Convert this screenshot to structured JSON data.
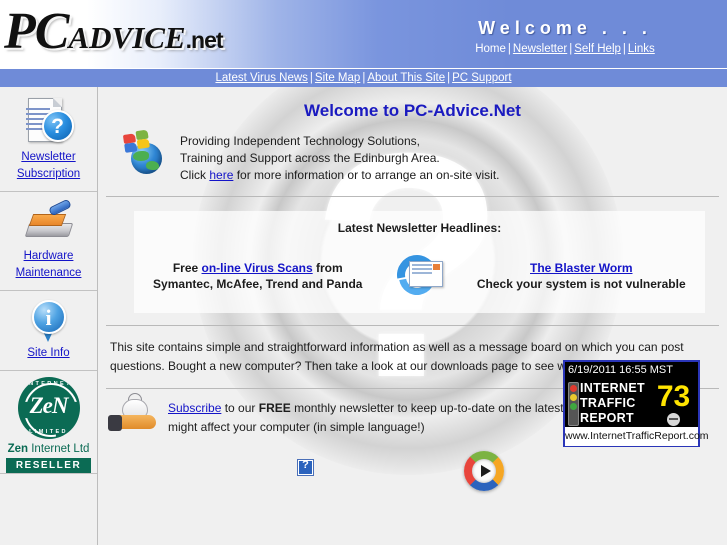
{
  "header": {
    "logo": {
      "pc": "PC",
      "advice": "ADVICE",
      "net": ".net",
      "alt": "PC-Advice.net logo"
    },
    "welcome_title": "Welcome . . .",
    "nav": [
      {
        "label": "Home",
        "link": false
      },
      {
        "label": "Newsletter",
        "link": true
      },
      {
        "label": "Self Help",
        "link": true
      },
      {
        "label": "Links",
        "link": true
      }
    ],
    "separator": "|"
  },
  "subnav": {
    "items": [
      {
        "label": "Latest Virus News"
      },
      {
        "label": "Site Map"
      },
      {
        "label": "About This Site"
      },
      {
        "label": "PC Support"
      }
    ],
    "separator": "|"
  },
  "sidebar": {
    "items": [
      {
        "label_line1": "Newsletter",
        "label_line2": "Subscription",
        "icon": "document-question-icon"
      },
      {
        "label_line1": "Hardware",
        "label_line2": "Maintenance",
        "icon": "hard-drive-brush-icon"
      },
      {
        "label_line1": "Site Info",
        "label_line2": "",
        "icon": "info-bubble-icon"
      }
    ],
    "zen": {
      "mark_text": "ZeN",
      "ring_top": "INTERNET",
      "ring_bottom": "LIMITED",
      "name_bold": "Zen",
      "name_rest": " Internet Ltd",
      "badge": "RESELLER"
    }
  },
  "main": {
    "page_title": "Welcome to PC-Advice.Net",
    "intro": {
      "line1": "Providing Independent Technology Solutions,",
      "line2": "Training and Support across the Edinburgh Area.",
      "line3_pre": "Click ",
      "line3_link": "here",
      "line3_post": " for more information or to arrange an on-site visit."
    },
    "newsletter": {
      "heading": "Latest Newsletter Headlines:",
      "left_pre": "Free ",
      "left_link": "on-line Virus Scans",
      "left_post": " from Symantec, McAfee, Trend and Panda",
      "right_link": "The Blaster Worm",
      "right_post": "Check your system is not vulnerable",
      "icon": "mail-refresh-icon"
    },
    "paragraph": "This site contains simple and straightforward information as well as a message board on which you can post questions. Bought a new computer? Then take a look at our downloads page to see what software you need.",
    "subscribe": {
      "link": "Subscribe",
      "pre": "",
      "mid1": " to our ",
      "bold": "FREE",
      "mid2": " monthly newsletter to keep up-to-date on the latest technology and how it might affect your computer (in simple language!)",
      "icon": "mouse-in-hand-icon"
    }
  },
  "traffic_report": {
    "datetime": "6/19/2011 16:55 MST",
    "title_line1": "INTERNET",
    "title_line2": "TRAFFIC",
    "title_line3": "REPORT",
    "index_value": "73",
    "url": "www.InternetTrafficReport.com"
  },
  "footer": {
    "broken_image_label": "broken-image-placeholder",
    "media_logo_label": "media-player-logo"
  },
  "colors": {
    "header_blue": "#6f8bd8",
    "link_blue": "#1414c8",
    "title_blue": "#1a1ac0",
    "zen_green": "#0b6b54",
    "itr_border": "#2a35b8",
    "itr_number": "#ffe400",
    "page_bg": "#f0f0f0"
  }
}
